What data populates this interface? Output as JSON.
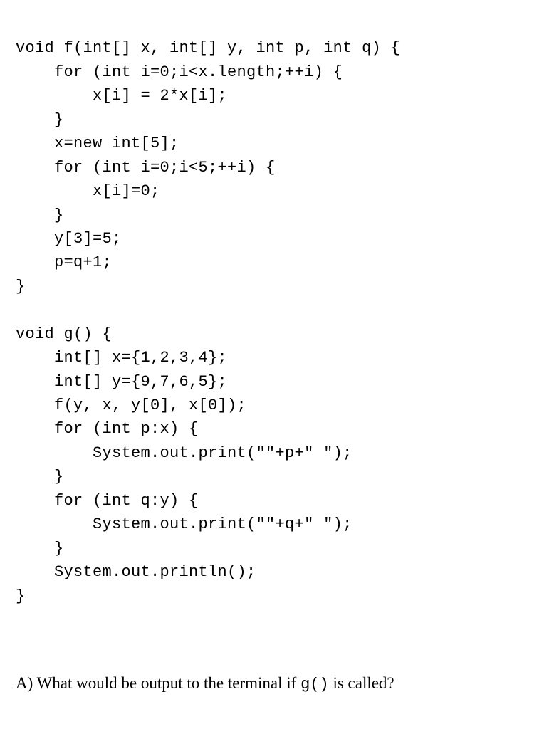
{
  "code": {
    "line1": "void f(int[] x, int[] y, int p, int q) {",
    "line2": "    for (int i=0;i<x.length;++i) {",
    "line3": "        x[i] = 2*x[i];",
    "line4": "    }",
    "line5": "    x=new int[5];",
    "line6": "    for (int i=0;i<5;++i) {",
    "line7": "        x[i]=0;",
    "line8": "    }",
    "line9": "    y[3]=5;",
    "line10": "    p=q+1;",
    "line11": "}",
    "line12": "",
    "line13": "void g() {",
    "line14": "    int[] x={1,2,3,4};",
    "line15": "    int[] y={9,7,6,5};",
    "line16": "    f(y, x, y[0], x[0]);",
    "line17": "    for (int p:x) {",
    "line18": "        System.out.print(\"\"+p+\" \");",
    "line19": "    }",
    "line20": "    for (int q:y) {",
    "line21": "        System.out.print(\"\"+q+\" \");",
    "line22": "    }",
    "line23": "    System.out.println();",
    "line24": "}"
  },
  "question": {
    "prefix": "A) What would be output to the terminal if ",
    "code_ref": "g()",
    "suffix": " is called?"
  }
}
